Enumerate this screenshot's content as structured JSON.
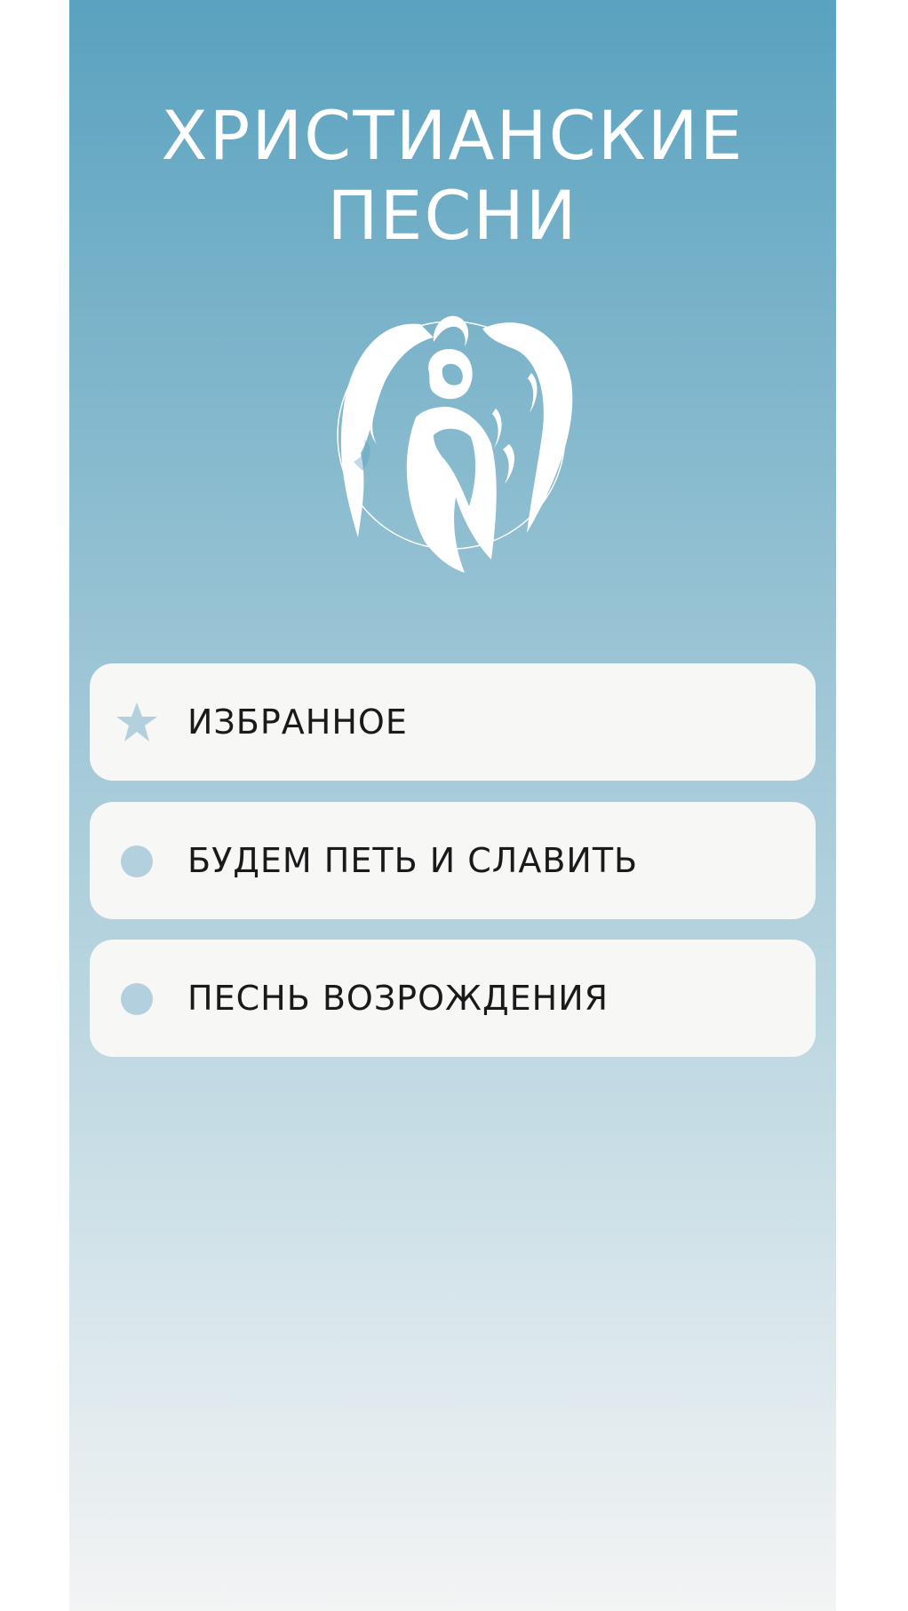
{
  "app": {
    "title_line1": "ХРИСТИАНСКИЕ",
    "title_line2": "ПЕСНИ"
  },
  "logo": {
    "icon": "angel-icon"
  },
  "menu": {
    "items": [
      {
        "label": "ИЗБРАННОЕ",
        "icon": "star-icon"
      },
      {
        "label": "БУДЕМ ПЕТЬ И СЛАВИТЬ",
        "icon": "dot-icon"
      },
      {
        "label": "ПЕСНЬ ВОЗРОЖДЕНИЯ",
        "icon": "dot-icon"
      }
    ]
  },
  "colors": {
    "gradient_top": "#5aa2bf",
    "gradient_bottom": "#f3f4f4",
    "card_bg": "#f7f7f6",
    "icon_color": "#b2d0dd",
    "text_color": "#1a1a1a"
  }
}
